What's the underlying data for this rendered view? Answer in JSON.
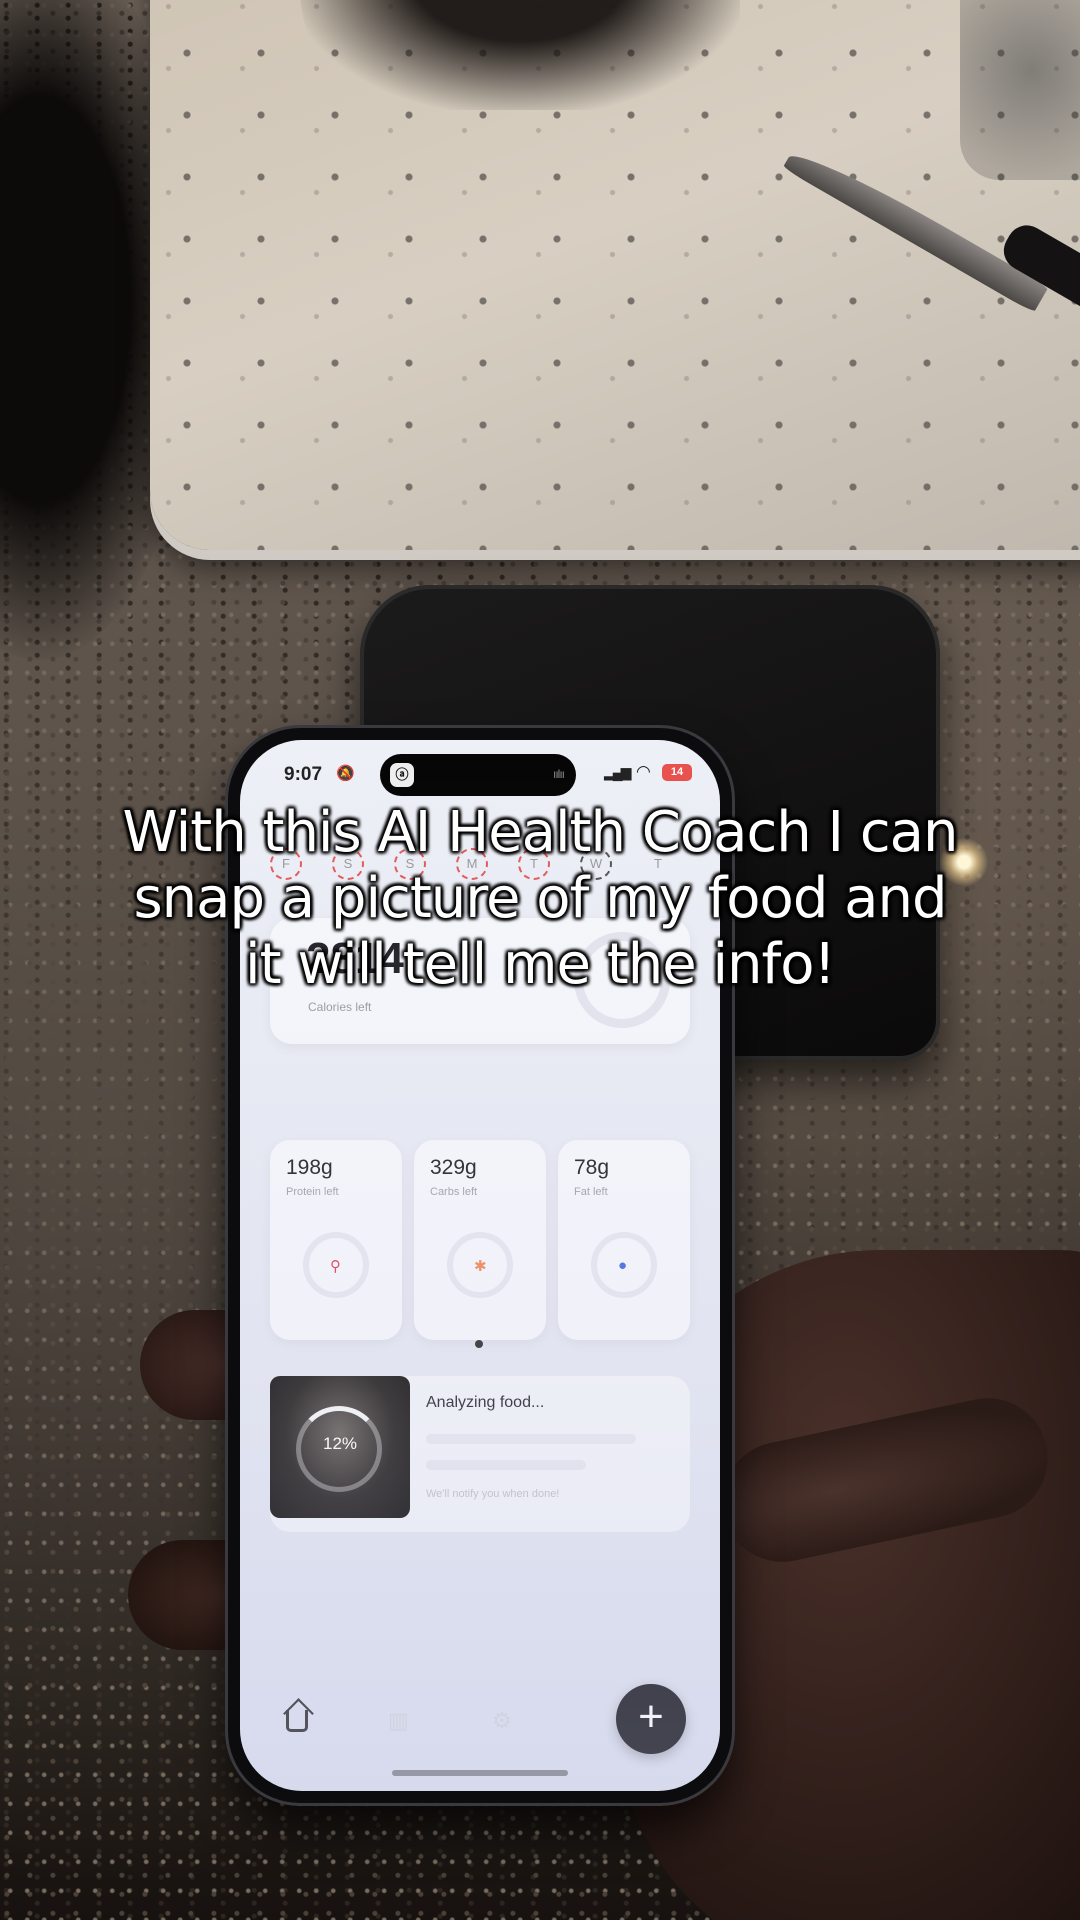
{
  "status_bar": {
    "time": "9:07",
    "battery": "14"
  },
  "week": {
    "days": [
      "F",
      "S",
      "S",
      "M",
      "T",
      "W",
      "T"
    ]
  },
  "calories": {
    "value": "2814",
    "label": "Calories left"
  },
  "macros": [
    {
      "value": "198g",
      "label": "Protein left",
      "color": "#e0455a"
    },
    {
      "value": "329g",
      "label": "Carbs left",
      "color": "#f08a5d"
    },
    {
      "value": "78g",
      "label": "Fat left",
      "color": "#4a6fdc"
    }
  ],
  "analyzing": {
    "progress": "12%",
    "title": "Analyzing food...",
    "note": "We'll notify you when done!"
  },
  "caption": {
    "text": "With this AI Health Coach I can snap a picture of my food and it will tell me the info!"
  }
}
